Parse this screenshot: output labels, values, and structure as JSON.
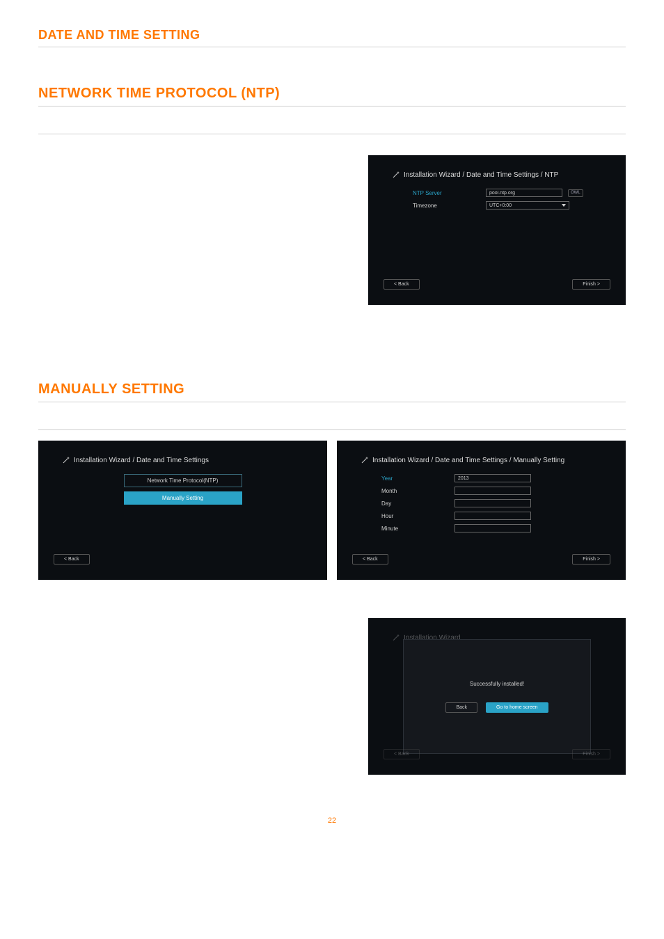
{
  "headings": {
    "main": "DATE AND TIME SETTING",
    "ntp": "NETWORK TIME PROTOCOL (NTP)",
    "manual": "MANUALLY SETTING"
  },
  "ntp_panel": {
    "breadcrumb": "Installation Wizard / Date and Time Settings / NTP",
    "server_label": "NTP Server",
    "server_value": "pool.ntp.org",
    "tag": "OWL",
    "tz_label": "Timezone",
    "tz_value": "UTC+0:00",
    "back": "< Back",
    "finish": "Finish >"
  },
  "dt_panel": {
    "breadcrumb": "Installation Wizard / Date and Time Settings",
    "opt_ntp": "Network Time Protocol(NTP)",
    "opt_manual": "Manually Setting",
    "back": "< Back"
  },
  "manual_panel": {
    "breadcrumb": "Installation Wizard / Date and Time Settings / Manually Setting",
    "year_label": "Year",
    "year_value": "2013",
    "month_label": "Month",
    "day_label": "Day",
    "hour_label": "Hour",
    "minute_label": "Minute",
    "back": "< Back",
    "finish": "Finish >"
  },
  "success_panel": {
    "breadcrumb": "Installation Wizard",
    "msg": "Successfully installed!",
    "back": "Back",
    "go": "Go to home screen",
    "bg_back": "< Back",
    "bg_finish": "Finish >"
  },
  "page_number": "22"
}
